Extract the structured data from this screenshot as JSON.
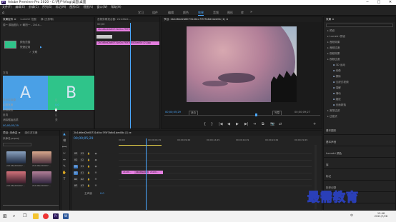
{
  "window": {
    "title": "Adobe Premiere Pro 2020 - C:\\用户\\Vlog\\桌面\\桌面",
    "controls": [
      "─",
      "□",
      "✕"
    ],
    "app_icon": "Pr"
  },
  "menu": [
    "文件(F)",
    "编辑(E)",
    "剪辑(C)",
    "序列(S)",
    "标记(M)",
    "图形(G)",
    "视图(V)",
    "窗口(W)",
    "帮助(H)"
  ],
  "workspaces": {
    "items": [
      "学习",
      "组件",
      "编辑",
      "颜色",
      "效果",
      "音频",
      "图形",
      "库"
    ],
    "active": "效果",
    "more": "»",
    "home": "⌂"
  },
  "effect_controls": {
    "tabs": [
      "效果控件 ≡",
      "Lumetri 范围",
      "源:(无剪辑)",
      "音频剪辑混合器: 2b1d6ed..."
    ],
    "source_line": "源 • 原始图片 > 朝阳一 - 2b1d...",
    "clip_line": "2b1d6ed2b60731d0cc7f5f7b6d1bed0b (1).jpg",
    "props": [
      {
        "label": "颜色范围",
        "value": ""
      },
      {
        "label": "快速应用",
        "value": "▶"
      },
      {
        "label": "不透明度",
        "value": ""
      },
      {
        "label": "",
        "value": "✓ 关联"
      }
    ],
    "wipe_label": "方向",
    "letter_a": "A",
    "letter_b": "B",
    "lower_props": [
      {
        "label": "显示实际源",
        "value": "□"
      },
      {
        "label": "边框宽度",
        "value": "0.0"
      },
      {
        "label": "边框颜色",
        "value": "▇"
      },
      {
        "label": "反向",
        "value": "□"
      },
      {
        "label": "消除锯齿品质",
        "value": "关"
      }
    ],
    "timecode": "00;00;05;29"
  },
  "timeline_mini": {
    "header": "00;00",
    "clip1": "2b1d6ed2b60731d0cc7f5f7b6d1bed0b (1).jpg",
    "clip2": "2b1d6ed2b60731d0cc7f5f7b6d1bed0b (2).jpg"
  },
  "program": {
    "tabs": [
      "节目: 2b1d6ed2b60731d0cc7f5f7b6d1bed0b (1) ≡"
    ],
    "timecode_left": "00;00;05;29",
    "fit_label": "适合",
    "quality": "完整",
    "timecode_right": "00;00;09;27",
    "controls": [
      "{",
      "}",
      "|◀",
      "◀",
      "▶",
      "▶|",
      "⇥",
      "⧉",
      "📷",
      "⇄",
      "+"
    ]
  },
  "effects_panel": {
    "title": "效果 ≡",
    "search_placeholder": "",
    "tree": [
      {
        "label": "预设",
        "depth": 0
      },
      {
        "label": "Lumetri 预设",
        "depth": 0
      },
      {
        "label": "音频效果",
        "depth": 0
      },
      {
        "label": "音频过渡",
        "depth": 0
      },
      {
        "label": "视频效果",
        "depth": 0
      },
      {
        "label": "视频过渡",
        "depth": 0
      },
      {
        "label": "3D 运动",
        "depth": 1
      },
      {
        "label": "划像",
        "depth": 1
      },
      {
        "label": "擦除",
        "depth": 1
      },
      {
        "label": "沉浸式视频",
        "depth": 1
      },
      {
        "label": "溶解",
        "depth": 1
      },
      {
        "label": "滑动",
        "depth": 1
      },
      {
        "label": "缩放",
        "depth": 1
      },
      {
        "label": "页面剥落",
        "depth": 1
      },
      {
        "label": "宽带过滤",
        "depth": 0
      },
      {
        "label": "过渡式",
        "depth": 0
      }
    ],
    "sections": [
      "基本图形",
      "基本声音",
      "Lumetri 颜色",
      "库",
      "标记",
      "历史记录",
      "信息"
    ]
  },
  "project": {
    "tabs": [
      "项目: 未命名 ≡",
      "媒体浏览器"
    ],
    "name": "未命名.prproj",
    "items": [
      {
        "name": "2b1d6ed2b607...",
        "dur": "5:00"
      },
      {
        "name": "2b1d6ed2b607...",
        "dur": "5:00"
      },
      {
        "name": "2b1d6ed2b607...",
        "dur": "5:00"
      },
      {
        "name": "2b1d6ed2b607...",
        "dur": "5:00"
      }
    ]
  },
  "sequence": {
    "tab": "2b1d6ed2b60731d0cc7f5f7b6d1bed0b (1) ≡",
    "timecode": "00;00;05;29",
    "ruler": [
      "00;00",
      "00;00;04;29",
      "00;00;09;29",
      "00;00;14;29",
      "00;00;19;29",
      "00;00;24;29",
      "00;00;29;29"
    ],
    "tracks": [
      "V3",
      "V2",
      "V1",
      "A1",
      "A2",
      "A3"
    ],
    "master_label": "主声道",
    "master_value": "0.0",
    "clip_left": "2b1d6...",
    "clip_mid": "2b1d6ed2b607...",
    "clip_right": "2b1d6..."
  },
  "taskbar": {
    "time": "15:46",
    "date": "2021/7/28",
    "lang": "中"
  },
  "watermark": "最需教育",
  "colors": {
    "accent": "#4aa8ff",
    "clip": "#e57fe0",
    "wipe_a": "#4aa0e6",
    "wipe_b": "#2fc48a"
  }
}
